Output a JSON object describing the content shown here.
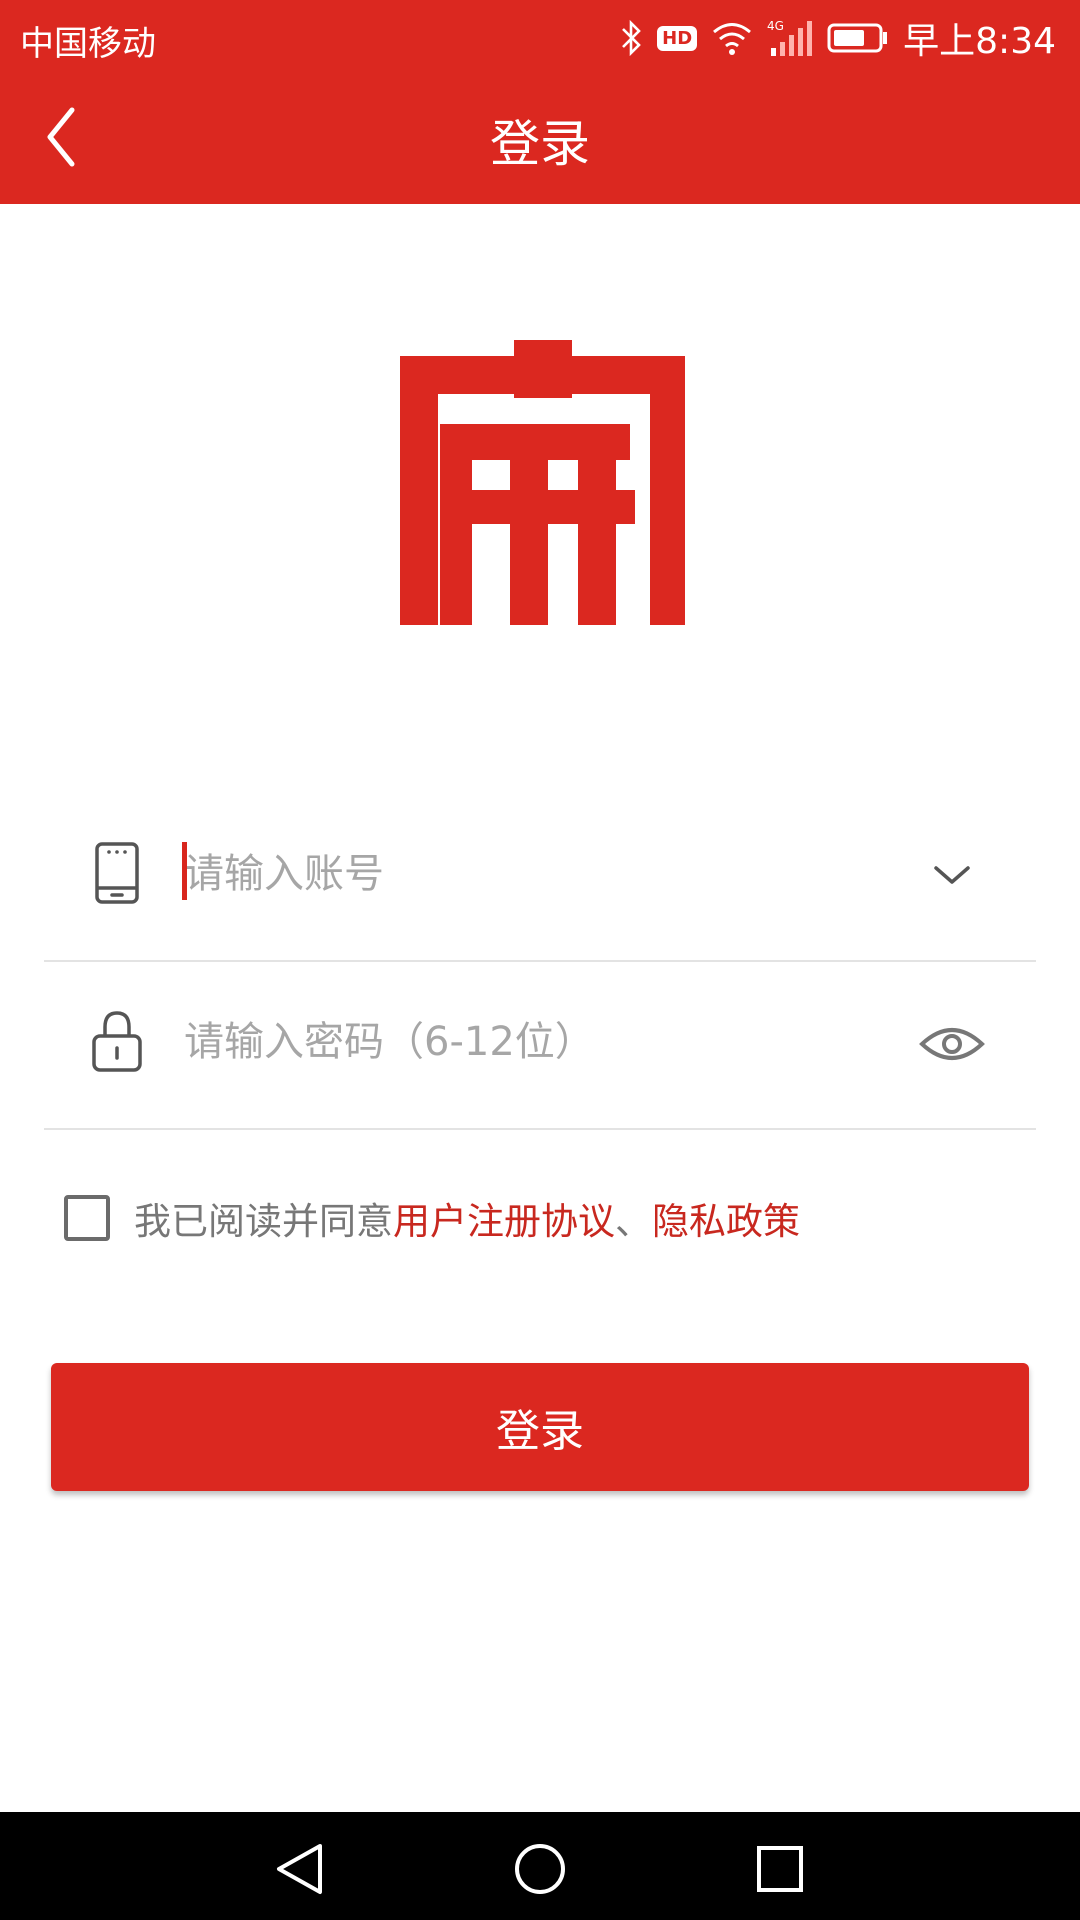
{
  "status_bar": {
    "carrier": "中国移动",
    "hd_badge": "HD",
    "network": "4G",
    "time": "早上8:34",
    "icons": [
      "bluetooth-icon",
      "hd-icon",
      "wifi-icon",
      "signal-icon",
      "battery-icon"
    ]
  },
  "app_bar": {
    "title": "登录",
    "back_icon": "chevron-left-icon"
  },
  "logo": {
    "icon": "brand-logo"
  },
  "form": {
    "account": {
      "placeholder": "请输入账号",
      "value": "",
      "icon": "phone-icon",
      "action_icon": "chevron-down-icon"
    },
    "password": {
      "placeholder": "请输入密码（6-12位）",
      "value": "",
      "icon": "lock-icon",
      "action_icon": "eye-icon"
    },
    "agreement": {
      "checked": false,
      "prefix": "我已阅读并同意",
      "link_terms": "用户注册协议",
      "separator": "、",
      "link_privacy": "隐私政策"
    },
    "login_button": "登录"
  },
  "navigation_bar": {
    "icons": [
      "nav-back-icon",
      "nav-home-icon",
      "nav-recent-icon"
    ]
  },
  "colors": {
    "primary": "#db2820",
    "link": "#c8281f",
    "placeholder": "#a6a6a6",
    "divider": "#e3e3e3"
  }
}
